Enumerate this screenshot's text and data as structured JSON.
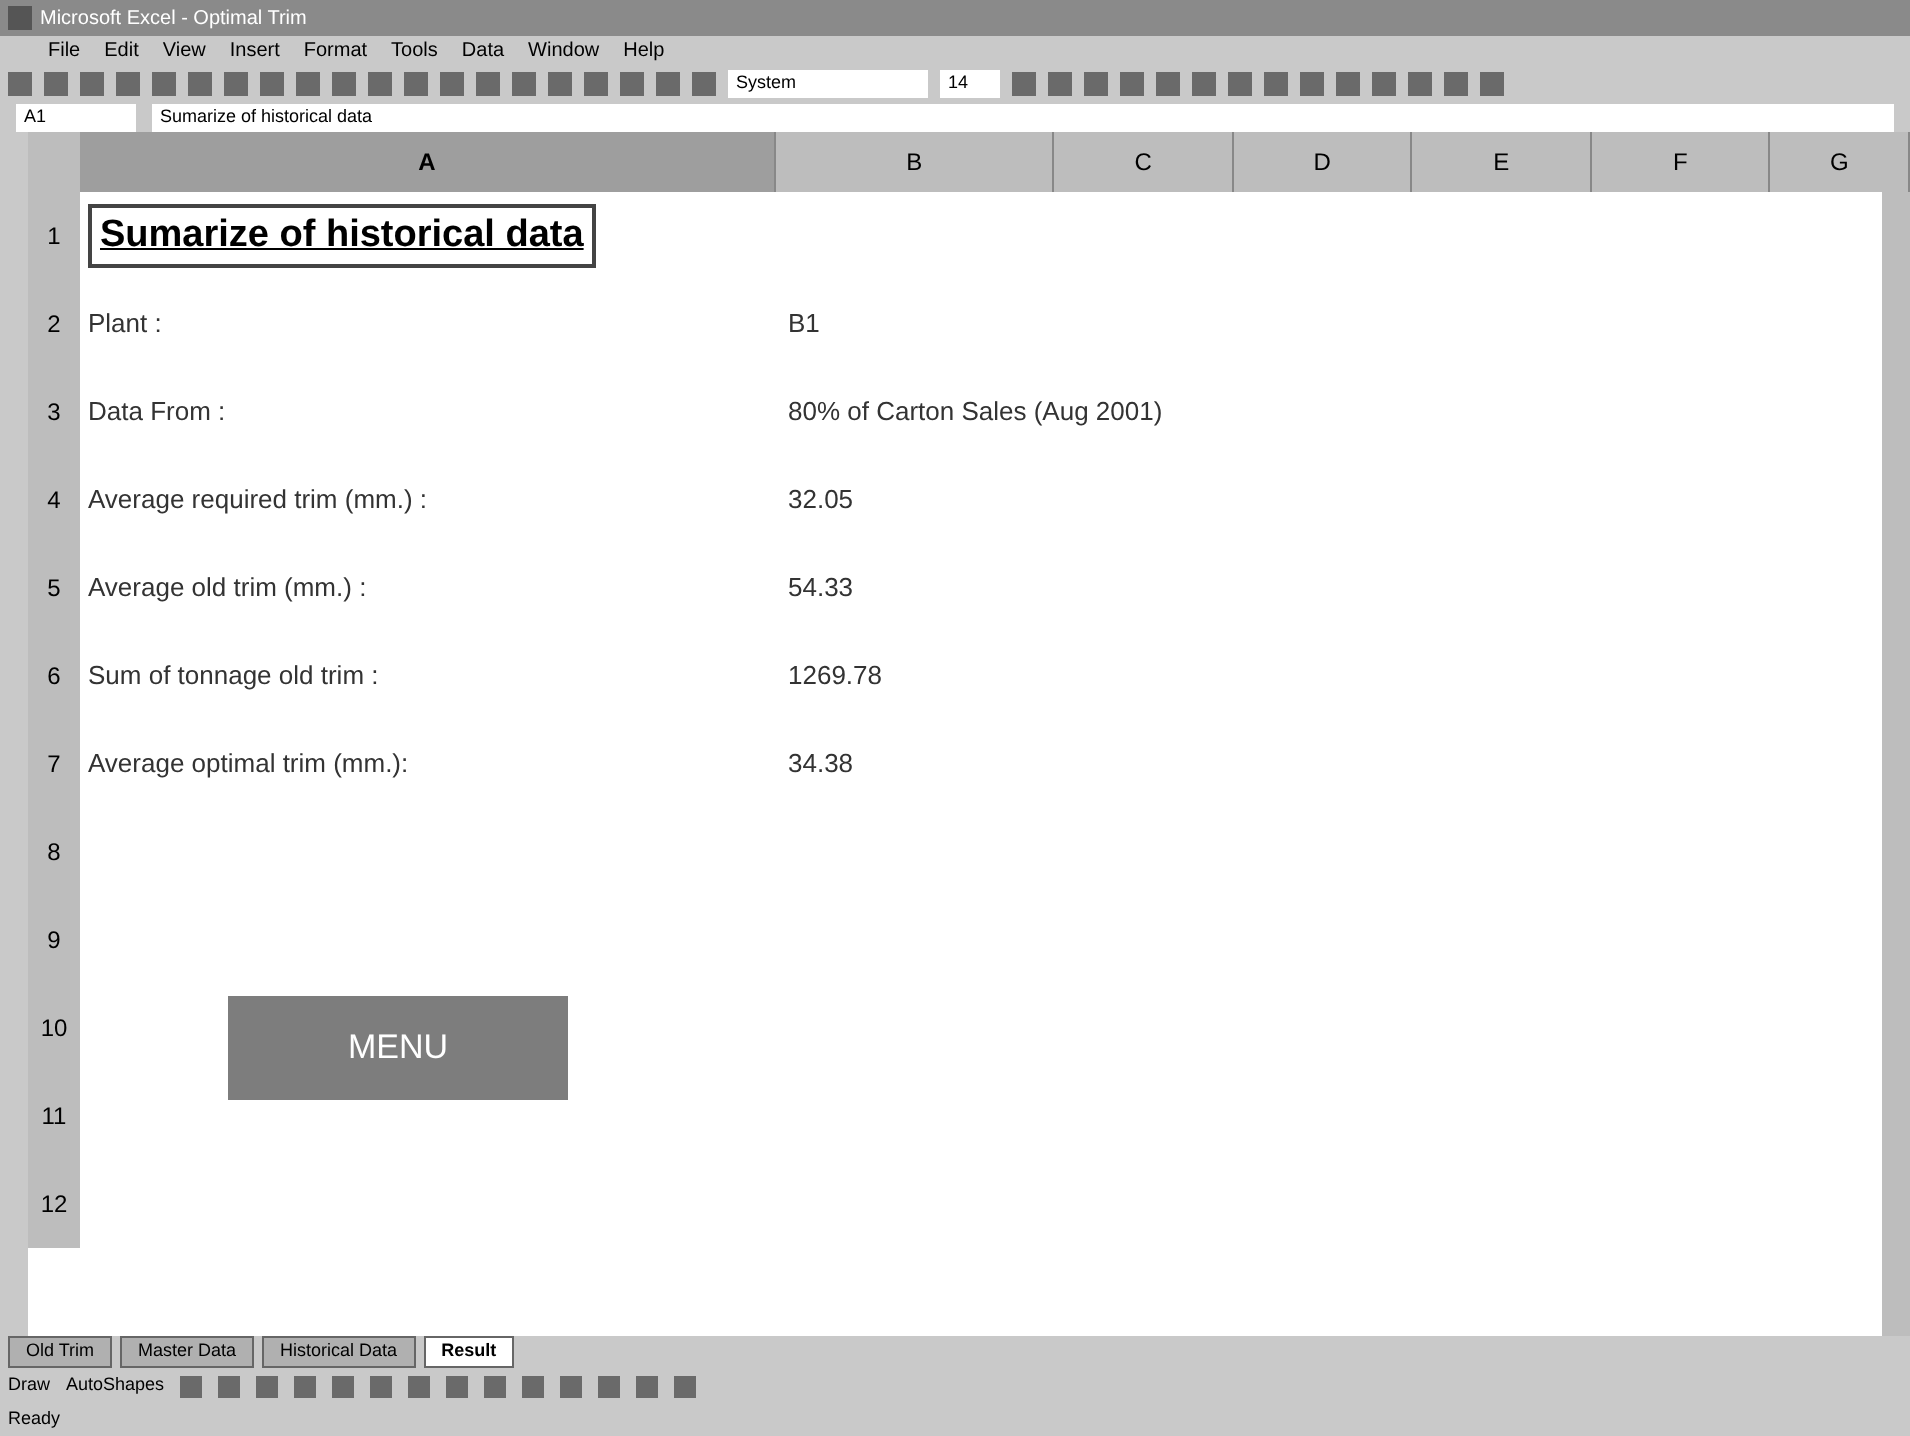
{
  "window": {
    "title": "Microsoft Excel - Optimal Trim"
  },
  "menu": [
    "File",
    "Edit",
    "View",
    "Insert",
    "Format",
    "Tools",
    "Data",
    "Window",
    "Help"
  ],
  "toolbar": {
    "font": "System",
    "size": "14"
  },
  "formula_bar": {
    "cell": "A1",
    "value": "Sumarize of historical data"
  },
  "columns": [
    {
      "label": "A",
      "selected": true
    },
    {
      "label": "B",
      "selected": false
    },
    {
      "label": "C",
      "selected": false
    },
    {
      "label": "D",
      "selected": false
    },
    {
      "label": "E",
      "selected": false
    },
    {
      "label": "F",
      "selected": false
    },
    {
      "label": "G",
      "selected": false
    }
  ],
  "rows": [
    {
      "number": "1",
      "kind": "title",
      "label": "Sumarize of historical data",
      "value": ""
    },
    {
      "number": "2",
      "kind": "pair",
      "label": "Plant :",
      "value": "B1"
    },
    {
      "number": "3",
      "kind": "pair",
      "label": "Data From :",
      "value": "80% of Carton Sales (Aug 2001)"
    },
    {
      "number": "4",
      "kind": "pair",
      "label": "Average required trim (mm.) :",
      "value": "32.05"
    },
    {
      "number": "5",
      "kind": "pair",
      "label": "Average old trim (mm.) :",
      "value": "54.33"
    },
    {
      "number": "6",
      "kind": "pair",
      "label": "Sum of tonnage old trim :",
      "value": "1269.78"
    },
    {
      "number": "7",
      "kind": "pair",
      "label": "Average optimal trim (mm.):",
      "value": "34.38"
    },
    {
      "number": "8",
      "kind": "empty",
      "label": "",
      "value": ""
    },
    {
      "number": "9",
      "kind": "empty",
      "label": "",
      "value": ""
    },
    {
      "number": "10",
      "kind": "button",
      "label": "MENU",
      "value": ""
    },
    {
      "number": "11",
      "kind": "empty",
      "label": "",
      "value": ""
    },
    {
      "number": "12",
      "kind": "empty",
      "label": "",
      "value": ""
    }
  ],
  "sheet_tabs": [
    {
      "label": "Old Trim",
      "selected": false
    },
    {
      "label": "Master Data",
      "selected": false
    },
    {
      "label": "Historical Data",
      "selected": false
    },
    {
      "label": "Result",
      "selected": true
    }
  ],
  "drawing_toolbar": {
    "draw": "Draw",
    "autoshapes": "AutoShapes"
  },
  "status_bar": "Ready"
}
